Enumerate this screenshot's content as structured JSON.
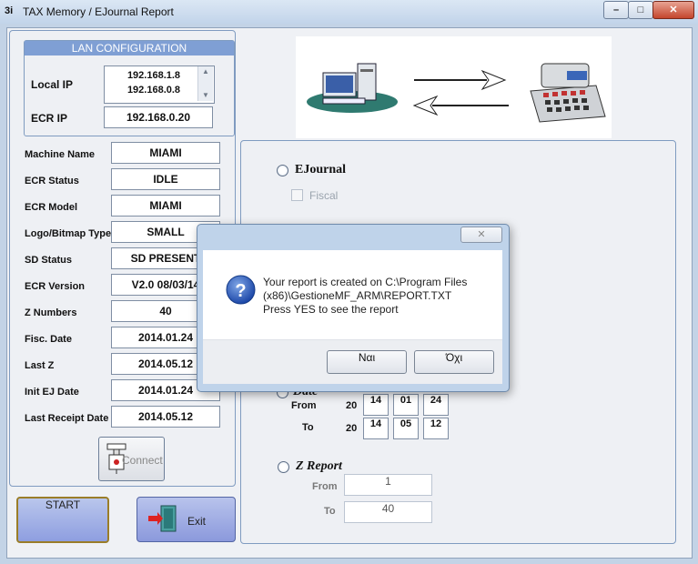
{
  "window": {
    "title": "TAX Memory / EJournal Report",
    "app_icon_text": "3i",
    "controls": {
      "minimize": "–",
      "maximize": "□",
      "close": "✕"
    }
  },
  "lan": {
    "header": "LAN CONFIGURATION",
    "local_ip_label": "Local IP",
    "local_ips": [
      "192.168.1.8",
      "192.168.0.8"
    ],
    "ecr_ip_label": "ECR IP",
    "ecr_ip": "192.168.0.20"
  },
  "info": [
    {
      "label": "Machine Name",
      "value": "MIAMI"
    },
    {
      "label": "ECR Status",
      "value": "IDLE"
    },
    {
      "label": "ECR Model",
      "value": "MIAMI"
    },
    {
      "label": "Logo/Bitmap Type",
      "value": "SMALL"
    },
    {
      "label": "SD Status",
      "value": "SD PRESENT"
    },
    {
      "label": "ECR Version",
      "value": "V2.0   08/03/14"
    },
    {
      "label": "Z Numbers",
      "value": "40"
    },
    {
      "label": "Fisc. Date",
      "value": "2014.01.24"
    },
    {
      "label": "Last Z",
      "value": "2014.05.12"
    },
    {
      "label": "Init EJ Date",
      "value": "2014.01.24"
    },
    {
      "label": "Last Receipt Date",
      "value": "2014.05.12"
    }
  ],
  "buttons": {
    "connect": "Connect",
    "start": "START",
    "exit": "Exit"
  },
  "report": {
    "ejournal_label": "EJournal",
    "fiscal_label": "Fiscal",
    "date_label": "Date",
    "from_label": "From",
    "to_label": "To",
    "date_from": {
      "century": "20",
      "year": "14",
      "month": "01",
      "day": "24"
    },
    "date_to": {
      "century": "20",
      "year": "14",
      "month": "05",
      "day": "12"
    },
    "zreport_label": "Z Report",
    "z_from": "1",
    "z_to": "40"
  },
  "dialog": {
    "close": "✕",
    "message_lines": [
      "Your report is created on C:\\Program Files",
      "(x86)\\GestioneMF_ARM\\REPORT.TXT",
      "Press YES to see the report"
    ],
    "yes": "Ναι",
    "no": "Όχι"
  }
}
